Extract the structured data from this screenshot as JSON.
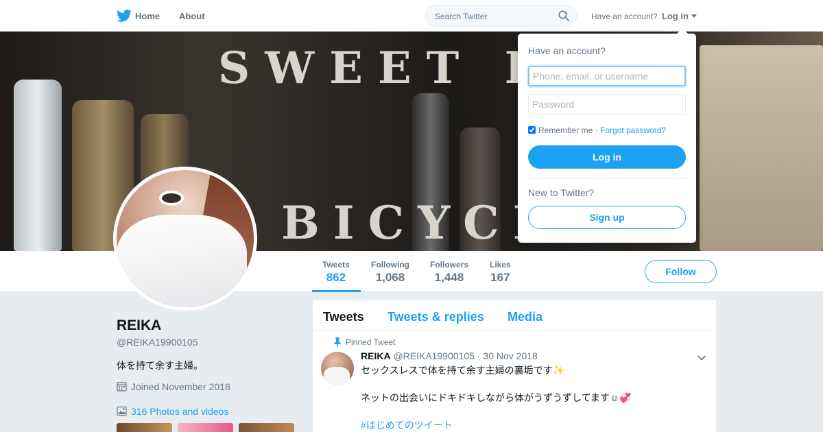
{
  "topnav": {
    "logo_icon": "twitter-bird-icon",
    "home_label": "Home",
    "about_label": "About",
    "search_placeholder": "Search Twitter",
    "have_account": "Have an account?",
    "login_label": "Log in"
  },
  "banner": {
    "word_top": "SWEET L",
    "word_bottom": "BICYCL"
  },
  "stats": [
    {
      "label": "Tweets",
      "value": "862"
    },
    {
      "label": "Following",
      "value": "1,068"
    },
    {
      "label": "Followers",
      "value": "1,448"
    },
    {
      "label": "Likes",
      "value": "167"
    }
  ],
  "follow_label": "Follow",
  "profile": {
    "name": "REIKA",
    "handle": "@REIKA19900105",
    "bio": "体を持て余す主婦。",
    "joined": "Joined November 2018",
    "photos": "316 Photos and videos"
  },
  "timeline": {
    "tabs": [
      "Tweets",
      "Tweets & replies",
      "Media"
    ],
    "pinned_label": "Pinned Tweet",
    "tweet": {
      "name": "REIKA",
      "handle": "@REIKA19900105",
      "date": "30 Nov 2018",
      "line1": "セックスレスで体を持て余す主婦の裏垢です✨",
      "line2": "ネットの出会いにドキドキしながら体がうずうずしてます☺💞",
      "hashtag": "#はじめてのツイート"
    }
  },
  "login_dropdown": {
    "title": "Have an account?",
    "username_placeholder": "Phone, email, or username",
    "password_placeholder": "Password",
    "remember_label": "Remember me",
    "separator": "·",
    "forgot_label": "Forgot password?",
    "login_button": "Log in",
    "new_label": "New to Twitter?",
    "signup_button": "Sign up"
  },
  "colors": {
    "accent": "#1da1f2",
    "muted": "#657786",
    "background": "#e6ecf0"
  }
}
